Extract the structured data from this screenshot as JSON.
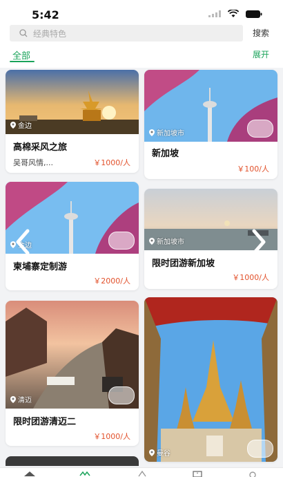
{
  "status_bar": {
    "time": "5:42"
  },
  "search": {
    "placeholder": "经典特色",
    "button": "搜索"
  },
  "tabs": {
    "active": "全部",
    "expand": "展开"
  },
  "cards": [
    {
      "location": "金边",
      "title": "高棉采风之旅",
      "subtitle": "吴哥风情,...",
      "price": "￥1000/人"
    },
    {
      "location": "新加坡市",
      "title": "新加坡",
      "price": "￥100/人"
    },
    {
      "location": "金边",
      "title": "柬埔寨定制游",
      "price": "￥2000/人"
    },
    {
      "location": "新加坡市",
      "title": "限时团游新加坡",
      "price": "￥1000/人"
    },
    {
      "location": "清迈",
      "title": "限时团游清迈二",
      "price": "￥1000/人"
    },
    {
      "location": "曼谷"
    }
  ],
  "colors": {
    "accent": "#1aa35a",
    "price": "#e2512b"
  }
}
